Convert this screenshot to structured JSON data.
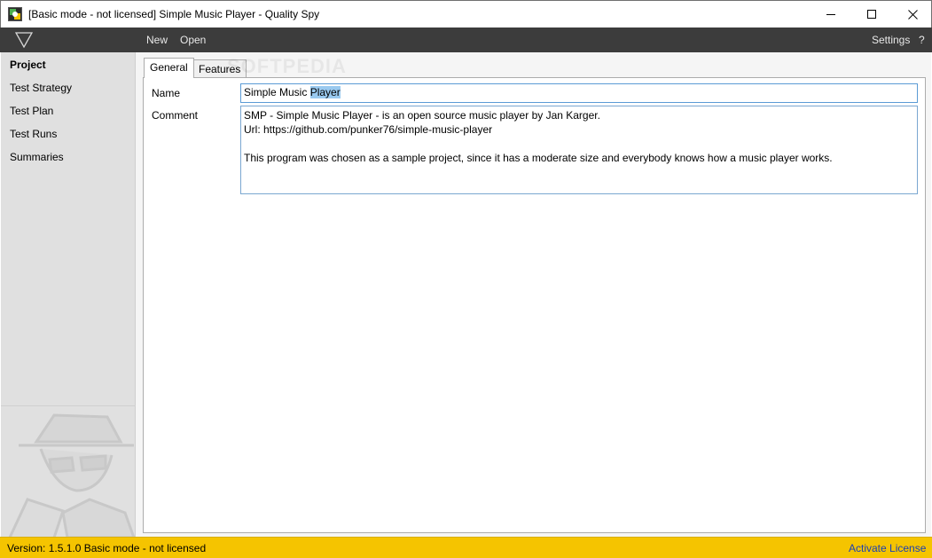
{
  "window": {
    "title": "[Basic mode - not licensed] Simple Music Player - Quality Spy"
  },
  "menubar": {
    "new_label": "New",
    "open_label": "Open",
    "settings_label": "Settings",
    "help_label": "?"
  },
  "sidebar": {
    "items": [
      {
        "label": "Project",
        "active": true
      },
      {
        "label": "Test Strategy",
        "active": false
      },
      {
        "label": "Test Plan",
        "active": false
      },
      {
        "label": "Test Runs",
        "active": false
      },
      {
        "label": "Summaries",
        "active": false
      }
    ]
  },
  "tabs": [
    {
      "label": "General",
      "selected": true
    },
    {
      "label": "Features",
      "selected": false
    }
  ],
  "form": {
    "name_label": "Name",
    "name_value_plain": "Simple Music ",
    "name_value_selected": "Player",
    "comment_label": "Comment",
    "comment_value": "SMP - Simple Music Player - is an open source music player by Jan Karger.\nUrl: https://github.com/punker76/simple-music-player\n\nThis program was chosen as a sample project, since it has a moderate size and everybody knows how a music player works."
  },
  "watermark": "SOFTPEDIA",
  "statusbar": {
    "status_text": "Version: 1.5.1.0  Basic mode - not licensed",
    "activate_label": "Activate License"
  },
  "colors": {
    "menubar": "#3c3c3c",
    "sidebar": "#e0e0e0",
    "statusbar": "#f5c400",
    "link": "#1a3fb5",
    "focus_border": "#5b9bd5"
  },
  "icons": {
    "app": "quality-spy-app-icon",
    "logo": "triangle-down-logo-icon",
    "minimize": "minimize-icon",
    "maximize": "maximize-icon",
    "close": "close-icon",
    "mascot": "spy-mascot-icon"
  }
}
